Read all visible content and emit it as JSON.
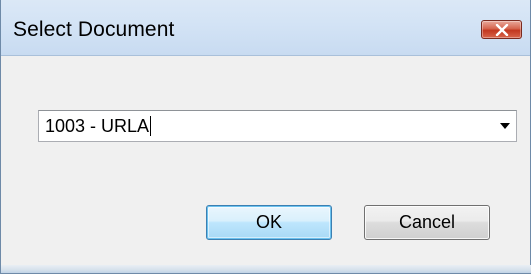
{
  "window": {
    "title": "Select Document",
    "close_icon": "close-x-icon"
  },
  "combo": {
    "value": "1003 - URLA",
    "arrow_icon": "dropdown-arrow-icon"
  },
  "buttons": {
    "ok_label": "OK",
    "cancel_label": "Cancel"
  },
  "colors": {
    "titlebar": "#d3e3f5",
    "close_button": "#c8432b",
    "dialog_background": "#f0f0f0",
    "default_button_border": "#3c7fb1"
  }
}
